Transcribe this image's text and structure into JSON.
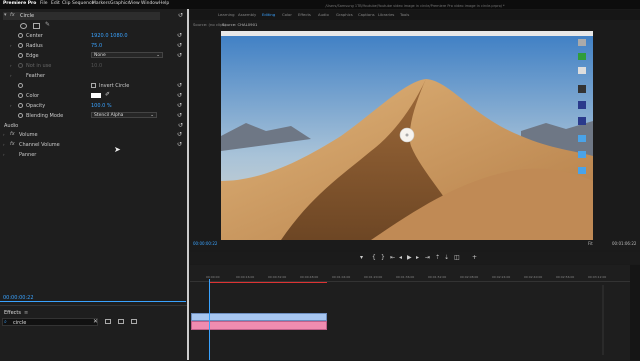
{
  "menubar": {
    "app": "Premiere Pro",
    "items": [
      "File",
      "Edit",
      "Clip",
      "Sequence",
      "Markers",
      "Graphics",
      "View",
      "Window",
      "Help"
    ]
  },
  "window_title": "/Users/Samsung 1TB/Youtube/Youtube video image in circle/Premiere Pro video image in circle.prproj *",
  "workspaces": [
    "Learning",
    "Assembly",
    "Editing",
    "Color",
    "Effects",
    "Audio",
    "Graphics",
    "Captions",
    "Libraries",
    "Tools"
  ],
  "workspaces_active": 2,
  "effect_controls": {
    "effect_name": "Circle",
    "properties": [
      {
        "name": "Center",
        "value": "1920.0   1080.0",
        "kind": "value"
      },
      {
        "name": "Radius",
        "value": "75.0",
        "kind": "value"
      },
      {
        "name": "Edge",
        "value": "None",
        "kind": "dropdown"
      },
      {
        "name": "Not in use",
        "value": "10.0",
        "kind": "disabled"
      },
      {
        "name": "Feather",
        "value": "",
        "kind": "label"
      },
      {
        "name": "Invert Circle",
        "value": "",
        "kind": "checkbox"
      },
      {
        "name": "Color",
        "value": "",
        "kind": "color"
      },
      {
        "name": "Opacity",
        "value": "100.0 %",
        "kind": "value"
      },
      {
        "name": "Blending Mode",
        "value": "Stencil Alpha",
        "kind": "dropdown"
      }
    ],
    "audio_section": "Audio",
    "audio_items": [
      "Volume",
      "Channel Volume",
      "Panner"
    ],
    "timecode": "00:00:00:22"
  },
  "effects_panel": {
    "title": "Effects",
    "search_value": "circle"
  },
  "monitor": {
    "source_tab": "Source: (no clips)",
    "program_tab": "Source: CHAL0901",
    "timecode_left": "00:00:00:22",
    "fit_label": "Fit",
    "timecode_right": "00:01:06:22"
  },
  "timeline": {
    "ruler_labels": [
      "00:00:00",
      "00:00:16:00",
      "00:00:32:00",
      "00:00:48:00",
      "00:01:04:00",
      "00:01:20:00",
      "00:01:36:00",
      "00:01:52:00",
      "00:02:08:00",
      "00:02:24:00",
      "00:02:40:00",
      "00:02:56:00",
      "00:03:12:00"
    ]
  },
  "colors": {
    "accent": "#3aa3ff",
    "video_clip": "#a7c6f0",
    "audio_clip": "#f08cb0",
    "sky_top": "#3d7ec4",
    "sand": "#c79a62"
  }
}
